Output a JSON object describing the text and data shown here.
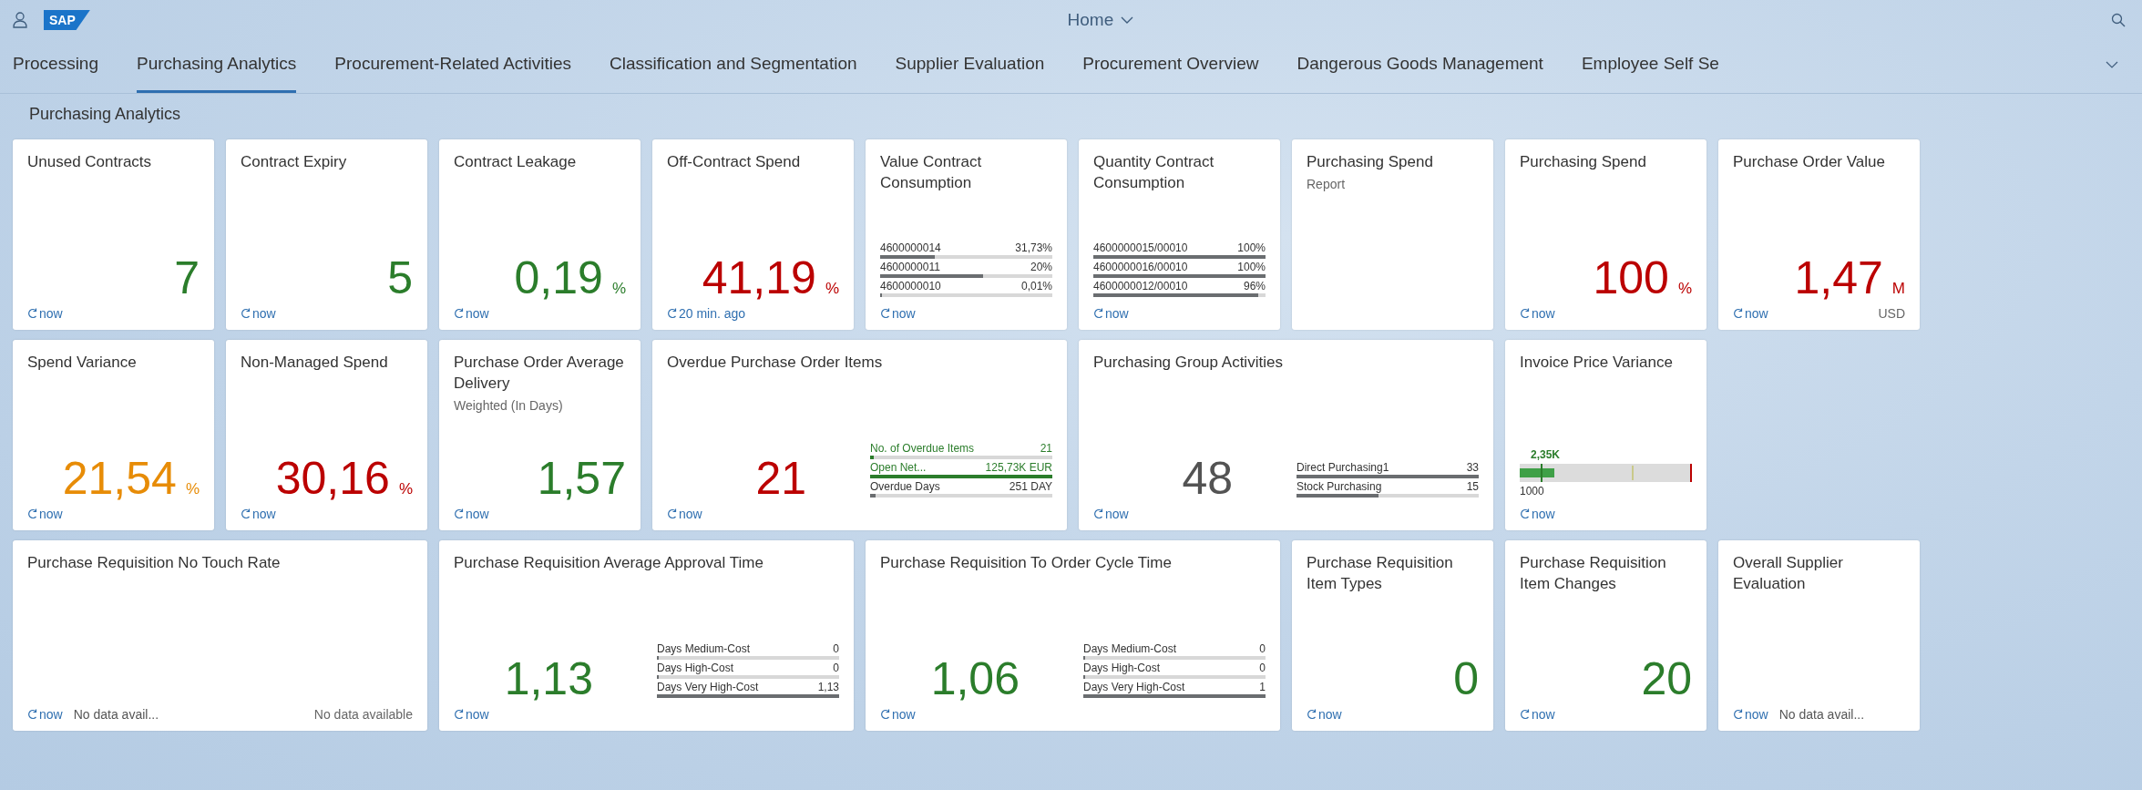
{
  "shell": {
    "logo": "SAP",
    "title": "Home"
  },
  "tabs": [
    {
      "label": "Processing",
      "selected": false
    },
    {
      "label": "Purchasing Analytics",
      "selected": true
    },
    {
      "label": "Procurement-Related Activities",
      "selected": false
    },
    {
      "label": "Classification and Segmentation",
      "selected": false
    },
    {
      "label": "Supplier Evaluation",
      "selected": false
    },
    {
      "label": "Procurement Overview",
      "selected": false
    },
    {
      "label": "Dangerous Goods Management",
      "selected": false
    },
    {
      "label": "Employee Self Se",
      "selected": false
    }
  ],
  "section_title": "Purchasing Analytics",
  "tiles": [
    {
      "kind": "number",
      "title": "Unused Contracts",
      "value": "7",
      "color": "#2b7d2b",
      "refresh": "now"
    },
    {
      "kind": "number",
      "title": "Contract Expiry",
      "value": "5",
      "color": "#2b7d2b",
      "refresh": "now"
    },
    {
      "kind": "number",
      "title": "Contract Leakage",
      "value": "0,19",
      "unit": "%",
      "color": "#2b7d2b",
      "refresh": "now"
    },
    {
      "kind": "number",
      "title": "Off-Contract Spend",
      "value": "41,19",
      "unit": "%",
      "color": "#bb0000",
      "refresh": "20 min. ago"
    },
    {
      "kind": "comparison",
      "title": "Value Contract Consumption",
      "refresh": "now",
      "rows": [
        {
          "label": "4600000014",
          "value": "31,73%",
          "level": 0.32,
          "color": "#6a6d70",
          "text_colored": false
        },
        {
          "label": "4600000011",
          "value": "20%",
          "level": 0.6,
          "color": "#6a6d70",
          "text_colored": false
        },
        {
          "label": "4600000010",
          "value": "0,01%",
          "level": 0.01,
          "color": "#6a6d70",
          "text_colored": false
        }
      ]
    },
    {
      "kind": "comparison",
      "title": "Quantity Contract Consumption",
      "refresh": "now",
      "rows": [
        {
          "label": "4600000015/00010",
          "value": "100%",
          "level": 1,
          "color": "#6a6d70",
          "text_colored": false
        },
        {
          "label": "4600000016/00010",
          "value": "100%",
          "level": 1,
          "color": "#6a6d70",
          "text_colored": false
        },
        {
          "label": "4600000012/00010",
          "value": "96%",
          "level": 0.96,
          "color": "#6a6d70",
          "text_colored": false
        }
      ]
    },
    {
      "kind": "report",
      "title": "Purchasing Spend",
      "subtitle": "Report"
    },
    {
      "kind": "number",
      "title": "Purchasing Spend",
      "value": "100",
      "unit": "%",
      "color": "#bb0000",
      "refresh": "now"
    },
    {
      "kind": "number",
      "title": "Purchase Order Value",
      "value": "1,47",
      "unit": "M",
      "color": "#bb0000",
      "refresh": "now",
      "footer_right": "USD"
    },
    {
      "kind": "number",
      "title": "Spend Variance",
      "value": "21,54",
      "unit": "%",
      "color": "#e78c07",
      "refresh": "now"
    },
    {
      "kind": "number",
      "title": "Non-Managed Spend",
      "value": "30,16",
      "unit": "%",
      "color": "#bb0000",
      "refresh": "now"
    },
    {
      "kind": "number",
      "title": "Purchase Order Average Delivery",
      "subtitle": "Weighted (In Days)",
      "value": "1,57",
      "color": "#2b7d2b",
      "refresh": "now"
    },
    {
      "kind": "comparison",
      "wide": true,
      "title": "Overdue Purchase Order Items",
      "value": "21",
      "color": "#bb0000",
      "refresh": "now",
      "rows": [
        {
          "label": "No. of Overdue Items",
          "value": "21",
          "level": 0.02,
          "color": "#2b7d2b",
          "text_colored": true
        },
        {
          "label": "Open Net...",
          "value": "125,73K EUR",
          "level": 1,
          "color": "#2b7d2b",
          "text_colored": true
        },
        {
          "label": "Overdue Days",
          "value": "251 DAY",
          "level": 0.03,
          "color": "#6a6d70",
          "text_colored": false
        }
      ]
    },
    {
      "kind": "comparison",
      "wide": true,
      "title": "Purchasing Group Activities",
      "value": "48",
      "color": "#535353",
      "refresh": "now",
      "rows": [
        {
          "label": "Direct Purchasing1",
          "value": "33",
          "level": 1,
          "color": "#6a6d70",
          "text_colored": false
        },
        {
          "label": "Stock Purchasing",
          "value": "15",
          "level": 0.45,
          "color": "#6a6d70",
          "text_colored": false
        }
      ]
    },
    {
      "kind": "bullet",
      "title": "Invoice Price Variance",
      "value": "2,35K",
      "target": "1000",
      "level": 0.2,
      "refresh": "now"
    },
    {
      "kind": "nodata",
      "wide": true,
      "title": "Purchase Requisition No Touch Rate",
      "refresh": "now",
      "note": "No data avail...",
      "footer_right": "No data available"
    },
    {
      "kind": "comparison",
      "wide": true,
      "title": "Purchase Requisition Average Approval Time",
      "value": "1,13",
      "color": "#2b7d2b",
      "refresh": "now",
      "rows": [
        {
          "label": "Days Medium-Cost",
          "value": "0",
          "level": 0,
          "color": "#6a6d70",
          "text_colored": false
        },
        {
          "label": "Days High-Cost",
          "value": "0",
          "level": 0,
          "color": "#6a6d70",
          "text_colored": false
        },
        {
          "label": "Days Very High-Cost",
          "value": "1,13",
          "level": 1,
          "color": "#6a6d70",
          "text_colored": false
        }
      ]
    },
    {
      "kind": "comparison",
      "wide": true,
      "title": "Purchase Requisition To Order Cycle Time",
      "value": "1,06",
      "color": "#2b7d2b",
      "refresh": "now",
      "rows": [
        {
          "label": "Days Medium-Cost",
          "value": "0",
          "level": 0,
          "color": "#6a6d70",
          "text_colored": false
        },
        {
          "label": "Days High-Cost",
          "value": "0",
          "level": 0,
          "color": "#6a6d70",
          "text_colored": false
        },
        {
          "label": "Days Very High-Cost",
          "value": "1",
          "level": 1,
          "color": "#6a6d70",
          "text_colored": false
        }
      ]
    },
    {
      "kind": "number",
      "title": "Purchase Requisition Item Types",
      "value": "0",
      "color": "#2b7d2b",
      "refresh": "now"
    },
    {
      "kind": "number",
      "title": "Purchase Requisition Item Changes",
      "value": "20",
      "color": "#2b7d2b",
      "refresh": "now"
    },
    {
      "kind": "nodata",
      "title": "Overall Supplier Evaluation",
      "refresh": "now",
      "note": "No data avail..."
    }
  ]
}
